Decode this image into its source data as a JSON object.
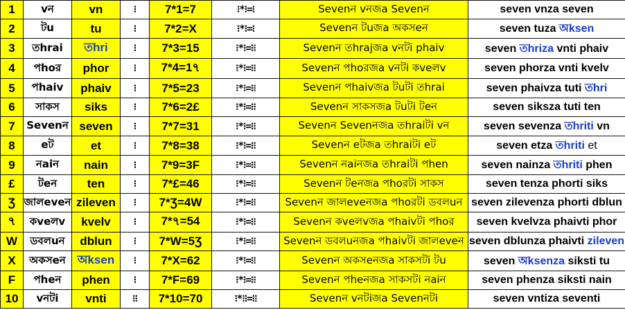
{
  "colors": {
    "yellow": "#ffff00",
    "blue": "#1a3ccc",
    "border": "#111111"
  },
  "rows": [
    {
      "n": "1",
      "bn": "vন",
      "lat": "vn",
      "glyph": "⁝",
      "eq": "7*1=7",
      "geq": "⁝*⁝=⁝",
      "sent": "Sevenন vনজa Sevenন",
      "eng": "seven vnza seven",
      "eng_parts": [
        {
          "t": "seven vnza seven",
          "c": ""
        }
      ],
      "blue_lat": false
    },
    {
      "n": "2",
      "bn": "টu",
      "lat": "tu",
      "glyph": "⁝",
      "eq": "7*2=X",
      "geq": "⁝*⁝=⁝",
      "sent": "Sevenন টuজa অকসeন",
      "eng": "",
      "eng_parts": [
        {
          "t": "seven tuza ",
          "c": ""
        },
        {
          "t": "অksen",
          "c": "blue"
        }
      ],
      "blue_lat": false
    },
    {
      "n": "3",
      "bn": "তhrai",
      "lat": "তhri",
      "glyph": "⁝",
      "eq": "7*3=15",
      "geq": "⁝*⁝=⁝⁝",
      "sent": "Sevenন তhrajজa vনটi phaiv",
      "eng": "",
      "eng_parts": [
        {
          "t": "seven ",
          "c": ""
        },
        {
          "t": "তhriza",
          "c": "blue"
        },
        {
          "t": " vnti phaiv",
          "c": ""
        }
      ],
      "blue_lat": true
    },
    {
      "n": "4",
      "bn": "পhoর",
      "lat": "phor",
      "glyph": "⁝",
      "eq": "7*4=1৭",
      "geq": "⁝*⁝=⁝⁝",
      "sent": "Sevenন পhoরজa vনটi কveলv",
      "eng": "",
      "eng_parts": [
        {
          "t": "seven phorza vnti kvelv",
          "c": ""
        }
      ],
      "blue_lat": false
    },
    {
      "n": "5",
      "bn": "পhaiv",
      "lat": "phaiv",
      "glyph": "⁝",
      "eq": "7*5=23",
      "geq": "⁝*⁝=⁝⁝",
      "sent": "Sevenন পhaivজa টuটi তhrai",
      "eng": "",
      "eng_parts": [
        {
          "t": "seven phaivza tuti ",
          "c": ""
        },
        {
          "t": "তhri",
          "c": "blue"
        }
      ],
      "blue_lat": false
    },
    {
      "n": "6",
      "bn": "সাকস",
      "lat": "siks",
      "glyph": "⁝",
      "eq": "7*6=2£",
      "geq": "⁝*⁝=⁝⁝",
      "sent": "Sevenন সাকসজa টuটi টeন",
      "eng": "",
      "eng_parts": [
        {
          "t": "seven siksza tuti ten",
          "c": ""
        }
      ],
      "blue_lat": false
    },
    {
      "n": "7",
      "bn": "Sevenন",
      "lat": "seven",
      "glyph": "⁝",
      "eq": "7*7=31",
      "geq": "⁝*⁝=⁝⁝",
      "sent": "Sevenন Sevenনজa তhraiটi vন",
      "eng": "",
      "eng_parts": [
        {
          "t": "seven sevenza ",
          "c": ""
        },
        {
          "t": "তhriti",
          "c": "blue"
        },
        {
          "t": " vn",
          "c": ""
        }
      ],
      "blue_lat": false
    },
    {
      "n": "8",
      "bn": "eট",
      "lat": "et",
      "glyph": "⁝",
      "eq": "7*8=38",
      "geq": "⁝*⁝=⁝⁝",
      "sent": "Sevenন eটজa তhraiটi eট",
      "eng": "",
      "eng_parts": [
        {
          "t": "seven etza ",
          "c": ""
        },
        {
          "t": "তhriti",
          "c": "blue"
        },
        {
          "t": " et",
          "c": "nb"
        }
      ],
      "blue_lat": false
    },
    {
      "n": "9",
      "bn": "নaiন",
      "lat": "nain",
      "glyph": "⁝",
      "eq": "7*9=3F",
      "geq": "⁝*⁝=⁝⁝",
      "sent": "Sevenন নaiনজa তhraiটi পhen",
      "eng": "",
      "eng_parts": [
        {
          "t": "seven nainza ",
          "c": ""
        },
        {
          "t": "তhriti",
          "c": "blue"
        },
        {
          "t": " phen",
          "c": ""
        }
      ],
      "blue_lat": false
    },
    {
      "n": "£",
      "bn": "টeন",
      "lat": "ten",
      "glyph": "⁝",
      "eq": "7*£=46",
      "geq": "⁝*⁝=⁝⁝",
      "sent": "Sevenন টeনজa পhoরটi সাকস",
      "eng": "",
      "eng_parts": [
        {
          "t": "seven tenza phorti siks",
          "c": ""
        }
      ],
      "blue_lat": false
    },
    {
      "n": "Ʒ",
      "bn": "জালeveন",
      "lat": "zileven",
      "glyph": "⁝",
      "eq": "7*Ʒ=4W",
      "geq": "⁝*⁝=⁝⁝",
      "sent": "Sevenন জালeveনজa পhoরটi ডবলuন",
      "eng": "",
      "eng_parts": [
        {
          "t": "seven zilevenza phorti dblun",
          "c": ""
        }
      ],
      "blue_lat": false
    },
    {
      "n": "৭",
      "bn": "কveলv",
      "lat": "kvelv",
      "glyph": "⁝",
      "eq": "7*৭=54",
      "geq": "⁝*⁝=⁝⁝",
      "sent": "Sevenন কveলvজa পhaivটi পhoর",
      "eng": "",
      "eng_parts": [
        {
          "t": "seven kvelvza phaivti phor",
          "c": ""
        }
      ],
      "blue_lat": false
    },
    {
      "n": "W",
      "bn": "ডবলuন",
      "lat": "dblun",
      "glyph": "⁝",
      "eq": "7*W=5Ʒ",
      "geq": "⁝*⁝=⁝⁝",
      "sent": "Sevenন ডবলuনজa পhaivটi জালeveন",
      "eng": "",
      "eng_parts": [
        {
          "t": "seven dblunza phaivti ",
          "c": ""
        },
        {
          "t": "zileven",
          "c": "blue"
        }
      ],
      "blue_lat": false
    },
    {
      "n": "X",
      "bn": "অকসeন",
      "lat": "অksen",
      "glyph": "⁝",
      "eq": "7*X=62",
      "geq": "⁝*⁝=⁝⁝",
      "sent": "Sevenন অকসeনজa সাকসটi টu",
      "eng": "",
      "eng_parts": [
        {
          "t": "seven ",
          "c": ""
        },
        {
          "t": "অksenza",
          "c": "blue"
        },
        {
          "t": " siksti tu",
          "c": ""
        }
      ],
      "blue_lat": true
    },
    {
      "n": "F",
      "bn": "পheন",
      "lat": "phen",
      "glyph": "⁝",
      "eq": "7*F=69",
      "geq": "⁝*⁝=⁝⁝",
      "sent": "Sevenন পheনজa সাকসটi নaiন",
      "eng": "",
      "eng_parts": [
        {
          "t": "seven phenza siksti nain",
          "c": ""
        }
      ],
      "blue_lat": false
    },
    {
      "n": "10",
      "bn": "vনটi",
      "lat": "vnti",
      "glyph": "⁝⁝",
      "eq": "7*10=70",
      "geq": "⁝*⁝⁝=⁝⁝",
      "sent": "Sevenন vনটiজa Sevenনটi",
      "eng": "",
      "eng_parts": [
        {
          "t": "seven vntiza seventi",
          "c": ""
        }
      ],
      "blue_lat": false
    }
  ]
}
